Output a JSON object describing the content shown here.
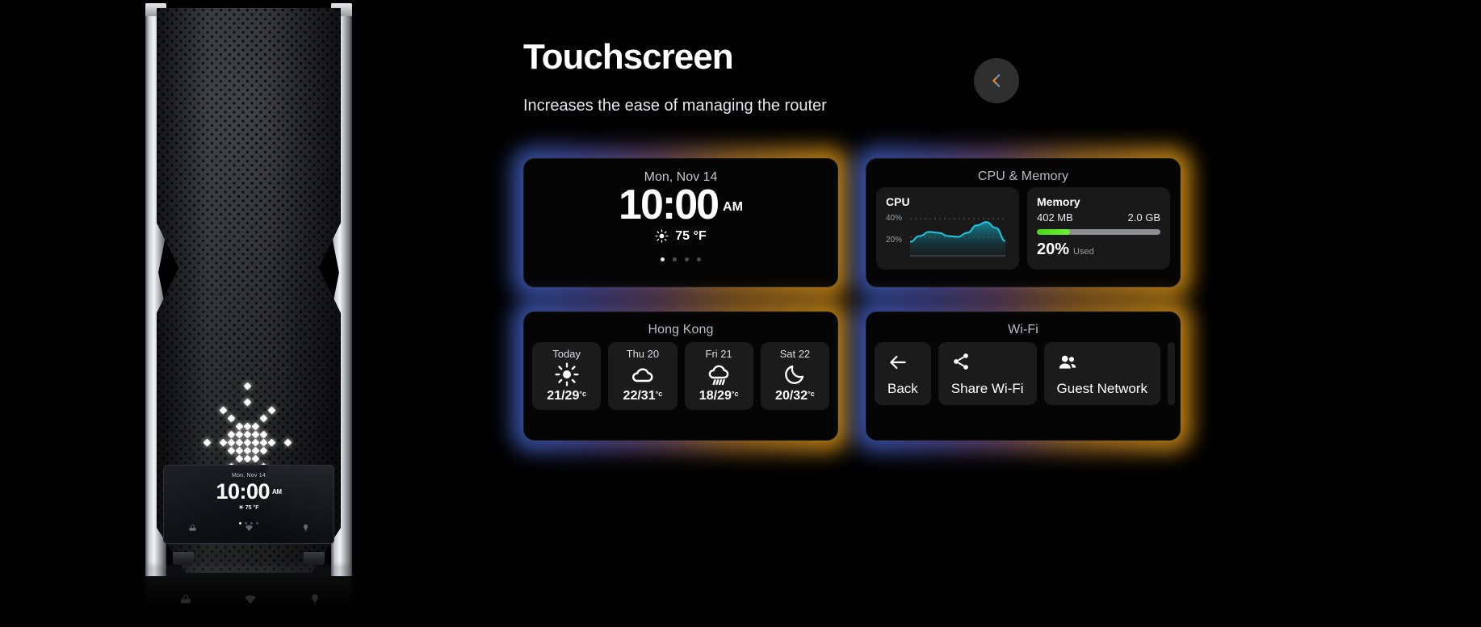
{
  "header": {
    "title": "Touchscreen",
    "subtitle": "Increases the ease of managing the router",
    "back_button": "back-chevron"
  },
  "clock_card": {
    "date": "Mon, Nov 14",
    "time": "10:00",
    "ampm": "AM",
    "temperature": "75 °F",
    "weather_icon": "sun-icon",
    "pager_dots": 4,
    "active_dot": 1
  },
  "cpu_memory_card": {
    "title": "CPU & Memory",
    "cpu": {
      "label": "CPU",
      "axis_labels": [
        "40%",
        "20%"
      ]
    },
    "memory": {
      "label": "Memory",
      "used": "402 MB",
      "total": "2.0 GB",
      "percent": "20%",
      "percent_suffix": "Used",
      "bar_fill_pct": 27,
      "bar_color": "#5fe024"
    }
  },
  "weather_card": {
    "title": "Hong Kong",
    "days": [
      {
        "day": "Today",
        "icon": "sun-icon",
        "temp": "21/29",
        "unit": "°c"
      },
      {
        "day": "Thu 20",
        "icon": "cloud-icon",
        "temp": "22/31",
        "unit": "°c"
      },
      {
        "day": "Fri 21",
        "icon": "rain-icon",
        "temp": "18/29",
        "unit": "°c"
      },
      {
        "day": "Sat 22",
        "icon": "moon-icon",
        "temp": "20/32",
        "unit": "°c"
      }
    ]
  },
  "wifi_card": {
    "title": "Wi-Fi",
    "actions": [
      {
        "label": "Back",
        "icon": "arrow-left-icon"
      },
      {
        "label": "Share Wi-Fi",
        "icon": "share-icon"
      },
      {
        "label": "Guest Network",
        "icon": "people-icon"
      }
    ]
  },
  "device": {
    "screen": {
      "date": "Mon, Nov 14",
      "time": "10:00",
      "ampm": "AM",
      "temperature": "75 °F",
      "nav_icons": [
        "device-icon",
        "wifi-icon",
        "bulb-icon"
      ]
    }
  },
  "chart_data": {
    "type": "area",
    "title": "CPU",
    "ylabel": "",
    "xlabel": "",
    "ylim": [
      0,
      50
    ],
    "yticks": [
      20,
      40
    ],
    "ytick_labels": [
      "20%",
      "40%"
    ],
    "grid": true,
    "legend": "none",
    "line_color": "#22c8e0",
    "fill_color": "#12545f",
    "x": [
      0,
      1,
      2,
      3,
      4,
      5,
      6,
      7,
      8,
      9,
      10
    ],
    "values": [
      17,
      24,
      29,
      28,
      24,
      23,
      28,
      37,
      41,
      34,
      18
    ]
  },
  "colors": {
    "background": "#000000",
    "glow_left": "#3f63c9",
    "glow_right": "#e39a16",
    "accent_cyan": "#22c8e0",
    "accent_green": "#5fe024"
  }
}
